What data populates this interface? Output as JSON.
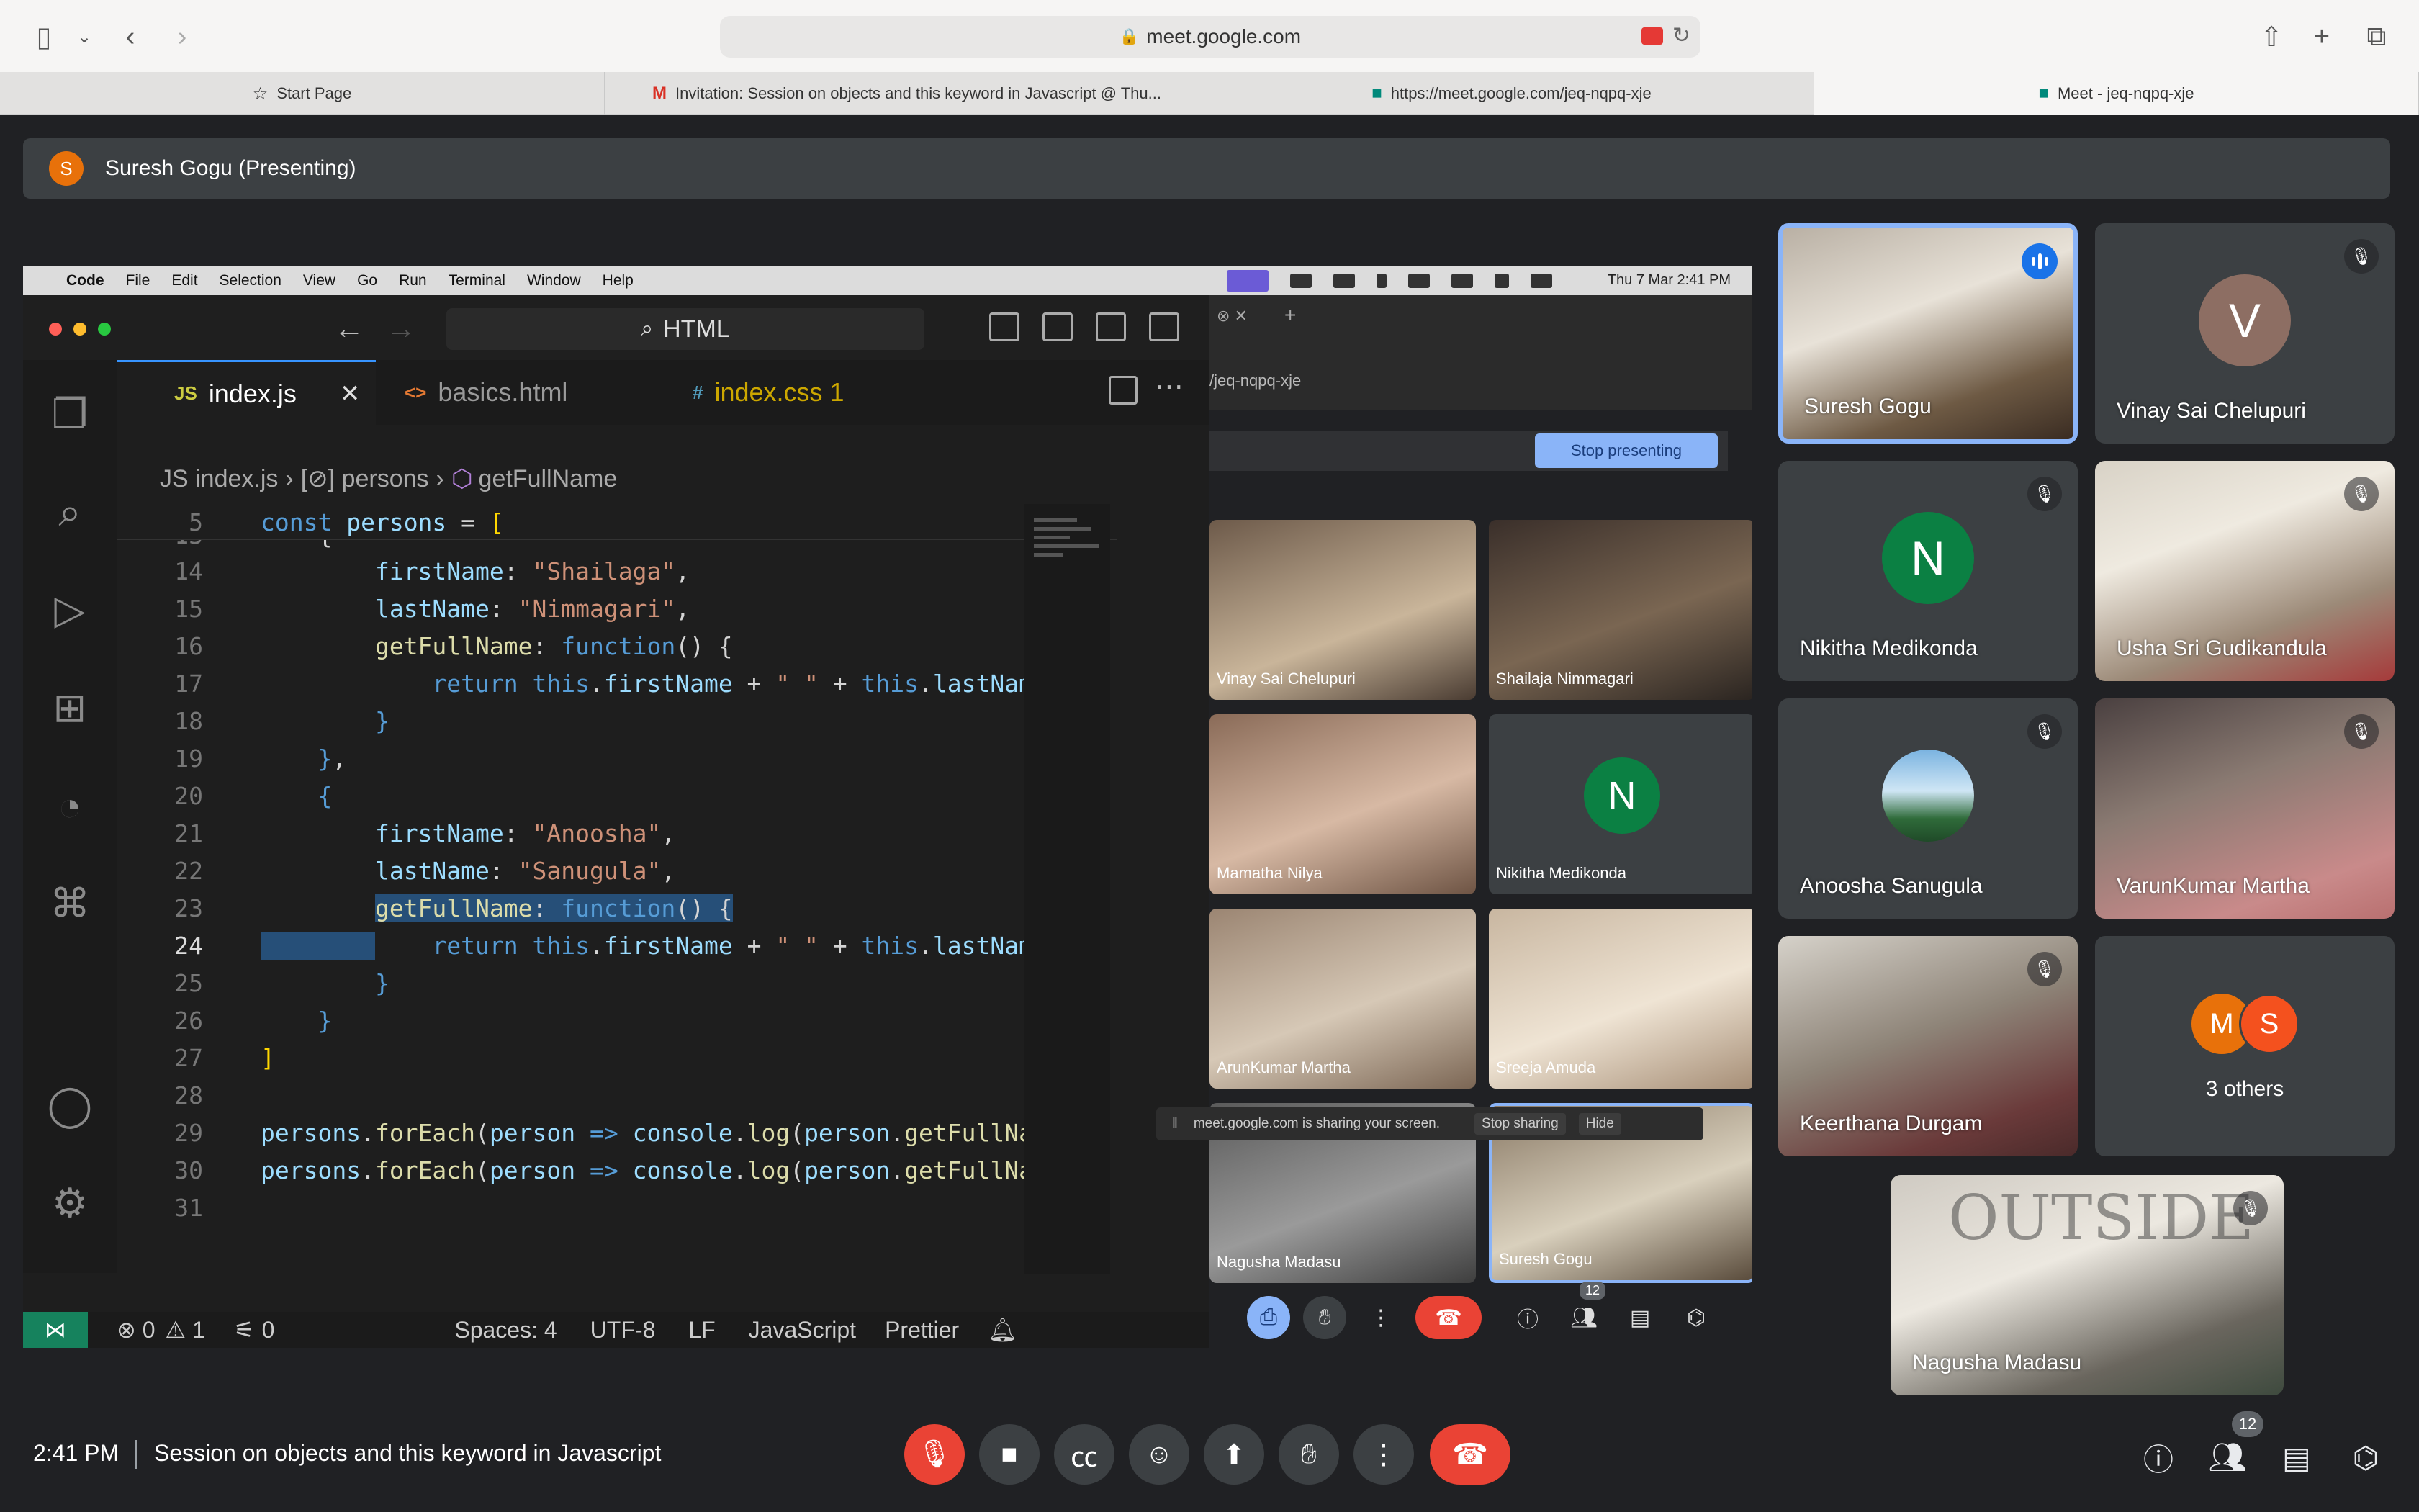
{
  "browser": {
    "address": "meet.google.com",
    "tabs": [
      {
        "label": "Start Page",
        "icon": "star-icon"
      },
      {
        "label": "Invitation: Session on objects and this keyword in Javascript @ Thu...",
        "icon": "gmail-icon"
      },
      {
        "label": "https://meet.google.com/jeq-nqpq-xje",
        "icon": "meet-icon"
      },
      {
        "label": "Meet - jeq-nqpq-xje",
        "icon": "meet-icon"
      }
    ]
  },
  "presenting": {
    "initial": "S",
    "label": "Suresh Gogu (Presenting)"
  },
  "shared_screen": {
    "menubar": {
      "app": "Code",
      "items": [
        "File",
        "Edit",
        "Selection",
        "View",
        "Go",
        "Run",
        "Terminal",
        "Window",
        "Help"
      ],
      "clock": "Thu 7 Mar  2:41 PM"
    },
    "vscode": {
      "search": "HTML",
      "tabs": [
        {
          "lang": "JS",
          "label": "index.js"
        },
        {
          "lang": "<>",
          "label": "basics.html"
        },
        {
          "lang": "#",
          "label": "index.css 1"
        }
      ],
      "breadcrumb": [
        "JS index.js",
        "[⊘] persons",
        "getFullName"
      ],
      "sticky_line": {
        "num": "5",
        "text": "const persons = ["
      },
      "lines": [
        {
          "num": "13",
          "text": "    {"
        },
        {
          "num": "14",
          "text": "        firstName: \"Shailaga\","
        },
        {
          "num": "15",
          "text": "        lastName: \"Nimmagari\","
        },
        {
          "num": "16",
          "text": "        getFullName: function() {"
        },
        {
          "num": "17",
          "text": "            return this.firstName + \" \" + this.lastName;"
        },
        {
          "num": "18",
          "text": "        }"
        },
        {
          "num": "19",
          "text": "    },"
        },
        {
          "num": "20",
          "text": "    {"
        },
        {
          "num": "21",
          "text": "        firstName: \"Anoosha\","
        },
        {
          "num": "22",
          "text": "        lastName: \"Sanugula\","
        },
        {
          "num": "23",
          "text": "        getFullName: function() {"
        },
        {
          "num": "24",
          "text": "            return this.firstName + \" \" + this.lastName;"
        },
        {
          "num": "25",
          "text": "        }"
        },
        {
          "num": "26",
          "text": "    }"
        },
        {
          "num": "27",
          "text": "]"
        },
        {
          "num": "28",
          "text": ""
        },
        {
          "num": "29",
          "text": "persons.forEach(person => console.log(person.getFullName"
        },
        {
          "num": "30",
          "text": "persons.forEach(person => console.log(person.getFullName"
        },
        {
          "num": "31",
          "text": ""
        }
      ],
      "status": {
        "errors": "⊗ 0",
        "warnings": "⚠ 1",
        "ports": "0",
        "spaces": "Spaces: 4",
        "encoding": "UTF-8",
        "eol": "LF",
        "language": "JavaScript",
        "formatter": "Prettier"
      }
    },
    "inner_meet": {
      "url": "/jeq-nqpq-xje",
      "stop_button": "Stop presenting",
      "tiles": [
        "Vinay Sai Chelupuri",
        "Shailaja Nimmagari",
        "Mamatha Nilya",
        "Nikitha Medikonda",
        "ArunKumar Martha",
        "Sreeja Amuda",
        "Nagusha Madasu",
        "Suresh Gogu"
      ],
      "share_notice": "meet.google.com is sharing your screen.",
      "share_stop": "Stop sharing",
      "share_hide": "Hide",
      "participant_count": "12"
    }
  },
  "participants": [
    {
      "name": "Suresh Gogu",
      "type": "video",
      "speaking": true,
      "initial": ""
    },
    {
      "name": "Vinay Sai Chelupuri",
      "type": "avatar",
      "initial": "V",
      "color": "#8d6e63"
    },
    {
      "name": "Nikitha Medikonda",
      "type": "avatar",
      "initial": "N",
      "color": "#0b8043"
    },
    {
      "name": "Usha Sri Gudikandula",
      "type": "video",
      "initial": ""
    },
    {
      "name": "Anoosha Sanugula",
      "type": "avatar-image",
      "initial": ""
    },
    {
      "name": "VarunKumar Martha",
      "type": "video",
      "initial": ""
    },
    {
      "name": "Keerthana Durgam",
      "type": "video",
      "initial": ""
    },
    {
      "name": "Nagusha Madasu",
      "type": "video",
      "initial": ""
    }
  ],
  "others": {
    "initials": [
      "M",
      "S"
    ],
    "colors": [
      "#e8710a",
      "#f4511e"
    ],
    "label": "3 others"
  },
  "bottom": {
    "time": "2:41 PM",
    "meeting_name": "Session on objects and this keyword in Javascript",
    "participant_count": "12"
  },
  "colors": {
    "meet_bg": "#202124",
    "tile_bg": "#3c4043",
    "leave_red": "#ea4335",
    "speaking_blue": "#1a73e8"
  }
}
